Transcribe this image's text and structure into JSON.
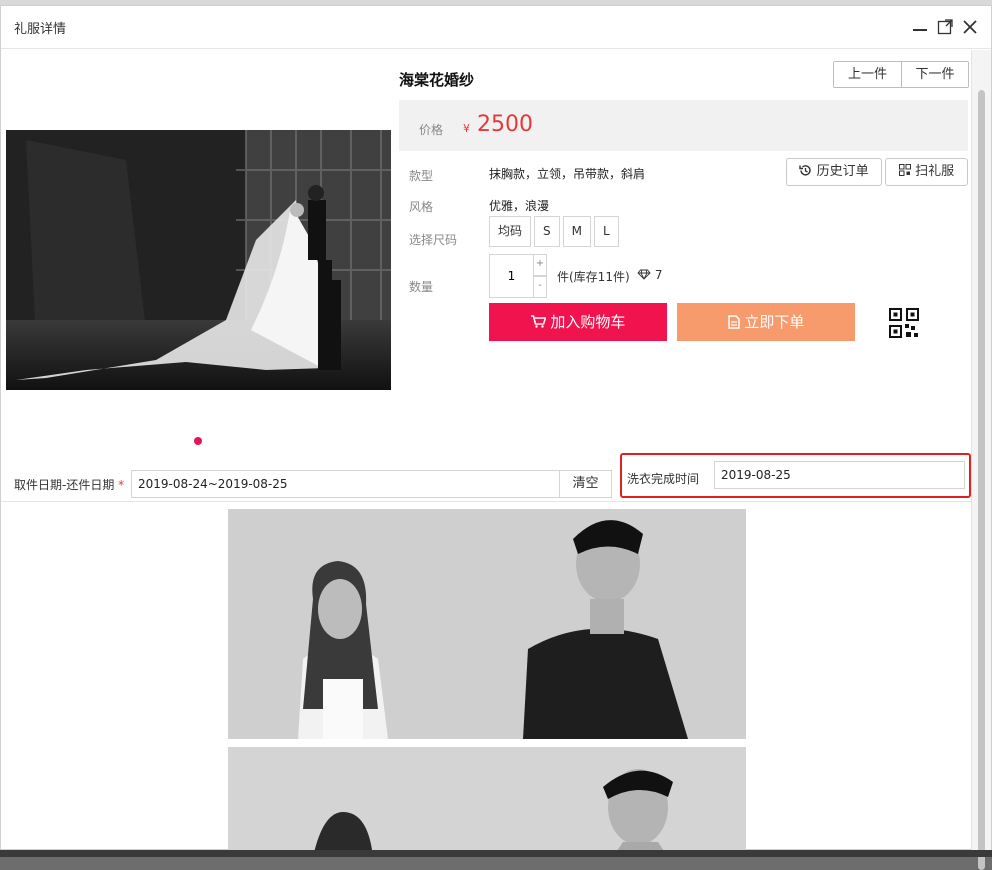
{
  "window": {
    "title": "礼服详情"
  },
  "product": {
    "title": "海棠花婚纱",
    "price_label": "价格",
    "currency": "¥",
    "price": "2500",
    "style_label": "款型",
    "style_value": "抹胸款，立领，吊带款，斜肩",
    "tone_label": "风格",
    "tone_value": "优雅，浪漫",
    "size_label": "选择尺码",
    "sizes": [
      "均码",
      "S",
      "M",
      "L"
    ],
    "qty_label": "数量",
    "qty_value": "1",
    "stock_text": "件(库存11件)",
    "gem_count": "7"
  },
  "nav": {
    "prev": "上一件",
    "next": "下一件"
  },
  "actions": {
    "history": "历史订单",
    "scan": "扫礼服",
    "add_cart": "加入购物车",
    "order_now": "立即下单"
  },
  "booking": {
    "pick_label": "取件日期-还件日期",
    "required_mark": "*",
    "pick_value": "2019-08-24~2019-08-25",
    "clear": "清空",
    "wash_label": "洗衣完成时间",
    "wash_value": "2019-08-25"
  },
  "colors": {
    "accent": "#e4393c",
    "cart": "#f0134e",
    "order": "#f79a6c",
    "highlight": "#e02020"
  }
}
